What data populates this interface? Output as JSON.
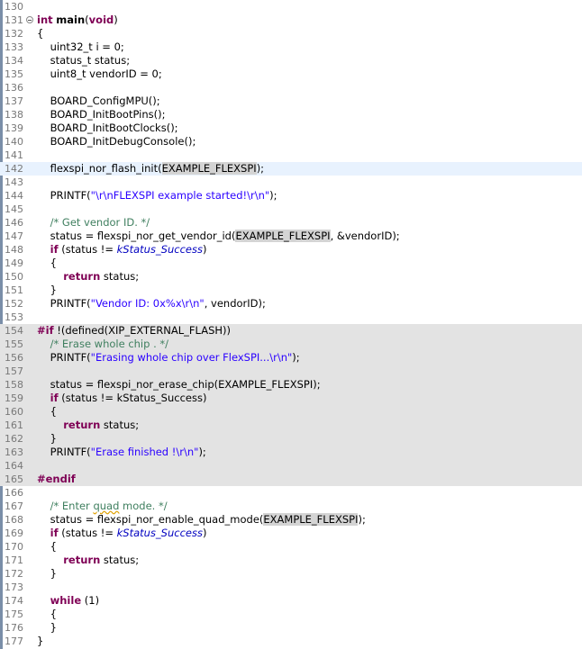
{
  "editor": {
    "lines": [
      {
        "n": "130",
        "fold": false,
        "hl": "",
        "segs": []
      },
      {
        "n": "131",
        "fold": true,
        "hl": "",
        "segs": [
          {
            "t": "int",
            "c": "kw"
          },
          {
            "t": " "
          },
          {
            "t": "main",
            "c": "b"
          },
          {
            "t": "("
          },
          {
            "t": "void",
            "c": "kw"
          },
          {
            "t": ")"
          }
        ]
      },
      {
        "n": "132",
        "fold": false,
        "hl": "",
        "segs": [
          {
            "t": "{"
          }
        ]
      },
      {
        "n": "133",
        "fold": false,
        "hl": "",
        "segs": [
          {
            "t": "    uint32_t i = 0;"
          }
        ]
      },
      {
        "n": "134",
        "fold": false,
        "hl": "",
        "segs": [
          {
            "t": "    status_t status;"
          }
        ]
      },
      {
        "n": "135",
        "fold": false,
        "hl": "",
        "segs": [
          {
            "t": "    uint8_t vendorID = 0;"
          }
        ]
      },
      {
        "n": "136",
        "fold": false,
        "hl": "",
        "segs": []
      },
      {
        "n": "137",
        "fold": false,
        "hl": "",
        "segs": [
          {
            "t": "    BOARD_ConfigMPU();"
          }
        ]
      },
      {
        "n": "138",
        "fold": false,
        "hl": "",
        "segs": [
          {
            "t": "    BOARD_InitBootPins();"
          }
        ]
      },
      {
        "n": "139",
        "fold": false,
        "hl": "",
        "segs": [
          {
            "t": "    BOARD_InitBootClocks();"
          }
        ]
      },
      {
        "n": "140",
        "fold": false,
        "hl": "",
        "segs": [
          {
            "t": "    BOARD_InitDebugConsole();"
          }
        ]
      },
      {
        "n": "141",
        "fold": false,
        "hl": "",
        "segs": []
      },
      {
        "n": "142",
        "fold": false,
        "hl": "current",
        "segs": [
          {
            "t": "    flexspi_nor_flash_init("
          },
          {
            "t": "EXAMPLE_FLEXSPI",
            "c": "occ"
          },
          {
            "t": ");"
          }
        ]
      },
      {
        "n": "143",
        "fold": false,
        "hl": "",
        "segs": []
      },
      {
        "n": "144",
        "fold": false,
        "hl": "",
        "segs": [
          {
            "t": "    PRINTF("
          },
          {
            "t": "\"\\r\\nFLEXSPI example started!\\r\\n\"",
            "c": "str"
          },
          {
            "t": ");"
          }
        ]
      },
      {
        "n": "145",
        "fold": false,
        "hl": "",
        "segs": []
      },
      {
        "n": "146",
        "fold": false,
        "hl": "",
        "segs": [
          {
            "t": "    "
          },
          {
            "t": "/* Get vendor ID. */",
            "c": "cmt"
          }
        ]
      },
      {
        "n": "147",
        "fold": false,
        "hl": "",
        "segs": [
          {
            "t": "    status = flexspi_nor_get_vendor_id("
          },
          {
            "t": "EXAMPLE_FLEXSPI",
            "c": "occ"
          },
          {
            "t": ", &vendorID);"
          }
        ]
      },
      {
        "n": "148",
        "fold": false,
        "hl": "",
        "segs": [
          {
            "t": "    "
          },
          {
            "t": "if",
            "c": "kw"
          },
          {
            "t": " (status != "
          },
          {
            "t": "kStatus_Success",
            "c": "enm"
          },
          {
            "t": ")"
          }
        ]
      },
      {
        "n": "149",
        "fold": false,
        "hl": "",
        "segs": [
          {
            "t": "    {"
          }
        ]
      },
      {
        "n": "150",
        "fold": false,
        "hl": "",
        "segs": [
          {
            "t": "        "
          },
          {
            "t": "return",
            "c": "kw"
          },
          {
            "t": " status;"
          }
        ]
      },
      {
        "n": "151",
        "fold": false,
        "hl": "",
        "segs": [
          {
            "t": "    }"
          }
        ]
      },
      {
        "n": "152",
        "fold": false,
        "hl": "",
        "segs": [
          {
            "t": "    PRINTF("
          },
          {
            "t": "\"Vendor ID: 0x%x\\r\\n\"",
            "c": "str"
          },
          {
            "t": ", vendorID);"
          }
        ]
      },
      {
        "n": "153",
        "fold": false,
        "hl": "",
        "segs": []
      },
      {
        "n": "154",
        "fold": false,
        "hl": "inactive",
        "segs": [
          {
            "t": "#if",
            "c": "pp"
          },
          {
            "t": " !(defined(XIP_EXTERNAL_FLASH))"
          }
        ]
      },
      {
        "n": "155",
        "fold": false,
        "hl": "inactive",
        "segs": [
          {
            "t": "    "
          },
          {
            "t": "/* Erase whole chip . */",
            "c": "cmt"
          }
        ]
      },
      {
        "n": "156",
        "fold": false,
        "hl": "inactive",
        "segs": [
          {
            "t": "    PRINTF("
          },
          {
            "t": "\"Erasing whole chip over FlexSPI...\\r\\n\"",
            "c": "str"
          },
          {
            "t": ");"
          }
        ]
      },
      {
        "n": "157",
        "fold": false,
        "hl": "inactive",
        "segs": []
      },
      {
        "n": "158",
        "fold": false,
        "hl": "inactive",
        "segs": [
          {
            "t": "    status = flexspi_nor_erase_chip(EXAMPLE_FLEXSPI);"
          }
        ]
      },
      {
        "n": "159",
        "fold": false,
        "hl": "inactive",
        "segs": [
          {
            "t": "    "
          },
          {
            "t": "if",
            "c": "kw"
          },
          {
            "t": " (status != kStatus_Success)"
          }
        ]
      },
      {
        "n": "160",
        "fold": false,
        "hl": "inactive",
        "segs": [
          {
            "t": "    {"
          }
        ]
      },
      {
        "n": "161",
        "fold": false,
        "hl": "inactive",
        "segs": [
          {
            "t": "        "
          },
          {
            "t": "return",
            "c": "kw"
          },
          {
            "t": " status;"
          }
        ]
      },
      {
        "n": "162",
        "fold": false,
        "hl": "inactive",
        "segs": [
          {
            "t": "    }"
          }
        ]
      },
      {
        "n": "163",
        "fold": false,
        "hl": "inactive",
        "segs": [
          {
            "t": "    PRINTF("
          },
          {
            "t": "\"Erase finished !\\r\\n\"",
            "c": "str"
          },
          {
            "t": ");"
          }
        ]
      },
      {
        "n": "164",
        "fold": false,
        "hl": "inactive",
        "segs": []
      },
      {
        "n": "165",
        "fold": false,
        "hl": "inactive",
        "segs": [
          {
            "t": "#endif",
            "c": "pp"
          }
        ]
      },
      {
        "n": "166",
        "fold": false,
        "hl": "",
        "segs": []
      },
      {
        "n": "167",
        "fold": false,
        "hl": "",
        "segs": [
          {
            "t": "    "
          },
          {
            "t": "/* Enter ",
            "c": "cmt"
          },
          {
            "t": "quad",
            "c": "cmt sq"
          },
          {
            "t": " mode. */",
            "c": "cmt"
          }
        ]
      },
      {
        "n": "168",
        "fold": false,
        "hl": "",
        "segs": [
          {
            "t": "    status = flexspi_nor_enable_quad_mode("
          },
          {
            "t": "EXAMPLE_FLEXSPI",
            "c": "occ"
          },
          {
            "t": ");"
          }
        ]
      },
      {
        "n": "169",
        "fold": false,
        "hl": "",
        "segs": [
          {
            "t": "    "
          },
          {
            "t": "if",
            "c": "kw"
          },
          {
            "t": " (status != "
          },
          {
            "t": "kStatus_Success",
            "c": "enm"
          },
          {
            "t": ")"
          }
        ]
      },
      {
        "n": "170",
        "fold": false,
        "hl": "",
        "segs": [
          {
            "t": "    {"
          }
        ]
      },
      {
        "n": "171",
        "fold": false,
        "hl": "",
        "segs": [
          {
            "t": "        "
          },
          {
            "t": "return",
            "c": "kw"
          },
          {
            "t": " status;"
          }
        ]
      },
      {
        "n": "172",
        "fold": false,
        "hl": "",
        "segs": [
          {
            "t": "    }"
          }
        ]
      },
      {
        "n": "173",
        "fold": false,
        "hl": "",
        "segs": []
      },
      {
        "n": "174",
        "fold": false,
        "hl": "",
        "segs": [
          {
            "t": "    "
          },
          {
            "t": "while",
            "c": "kw"
          },
          {
            "t": " (1)"
          }
        ]
      },
      {
        "n": "175",
        "fold": false,
        "hl": "",
        "segs": [
          {
            "t": "    {"
          }
        ]
      },
      {
        "n": "176",
        "fold": false,
        "hl": "",
        "segs": [
          {
            "t": "    }"
          }
        ]
      },
      {
        "n": "177",
        "fold": false,
        "hl": "",
        "segs": [
          {
            "t": "}"
          }
        ]
      }
    ]
  }
}
